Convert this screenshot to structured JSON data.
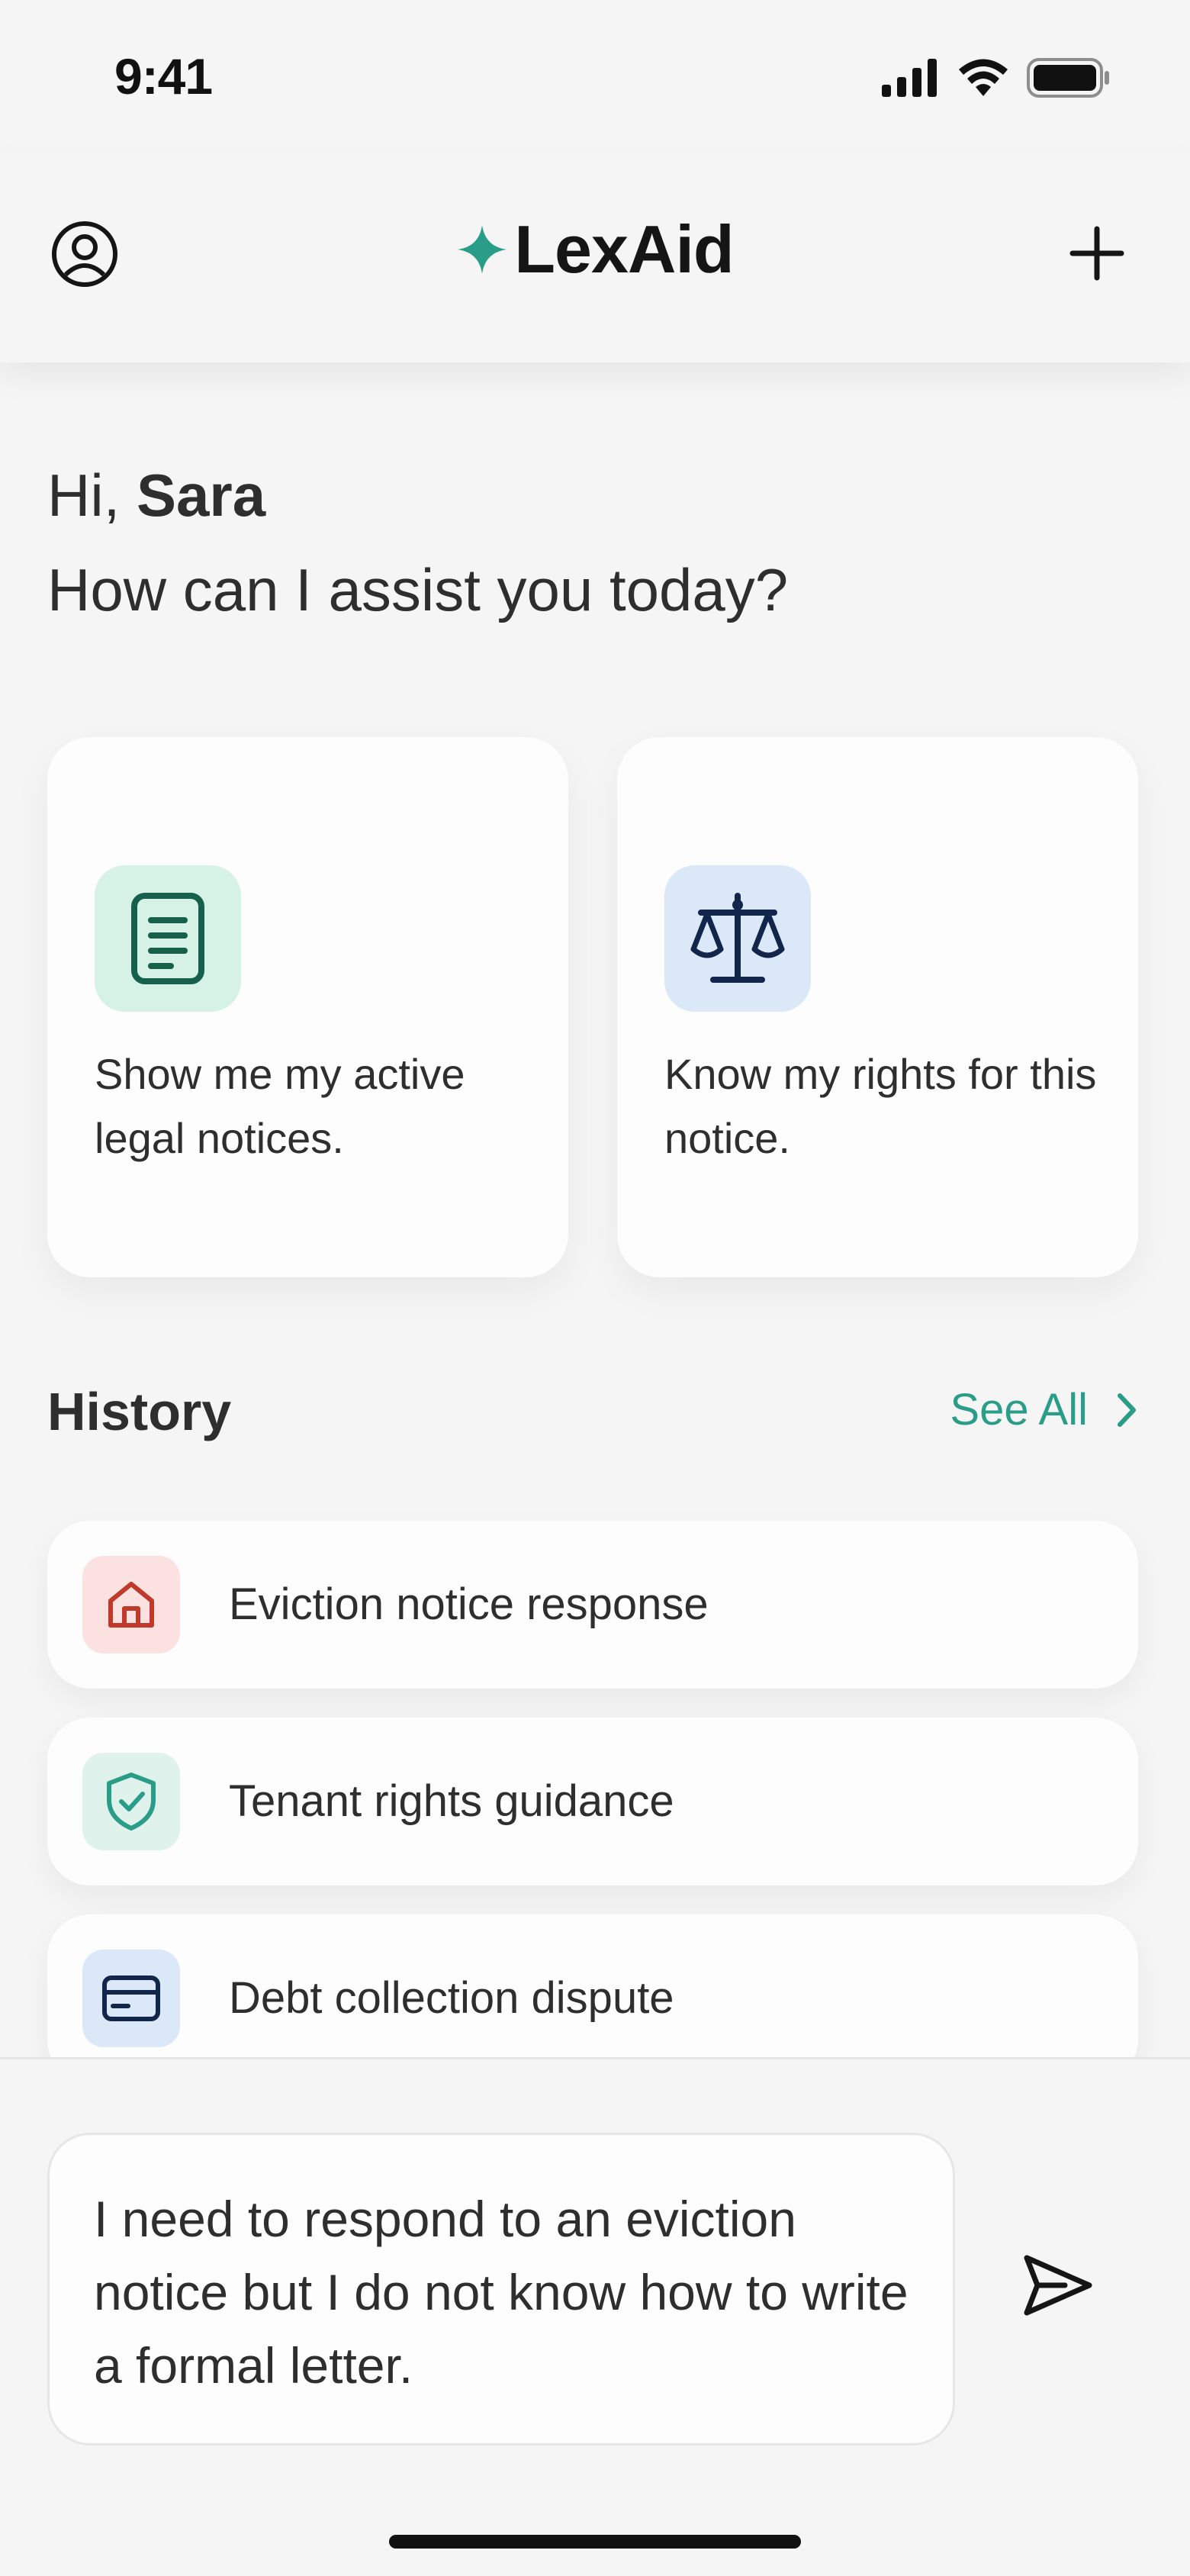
{
  "status_bar": {
    "time": "9:41"
  },
  "header": {
    "brand_name": "LexAid",
    "profile_icon": "user-circle-icon",
    "new_icon": "plus-icon",
    "brand_icon": "sparkle-icon",
    "accent_color": "#2a9d88"
  },
  "greeting": {
    "prefix": "Hi, ",
    "name": "Sara",
    "question": "How can I assist you today?"
  },
  "cards": [
    {
      "label": "Show me my active legal notices.",
      "icon": "document-icon",
      "icon_bg": "#d6f1e6"
    },
    {
      "label": "Know my rights for this notice.",
      "icon": "scales-icon",
      "icon_bg": "#dbe8f8"
    }
  ],
  "history": {
    "title": "History",
    "see_all": "See All",
    "items": [
      {
        "label": "Eviction notice response",
        "icon": "house-icon"
      },
      {
        "label": "Tenant rights guidance",
        "icon": "shield-check-icon"
      },
      {
        "label": "Debt collection dispute",
        "icon": "credit-card-icon"
      }
    ]
  },
  "composer": {
    "message": "I need to respond to an eviction notice but I do not know how to write a formal letter.",
    "send_icon": "send-icon"
  }
}
